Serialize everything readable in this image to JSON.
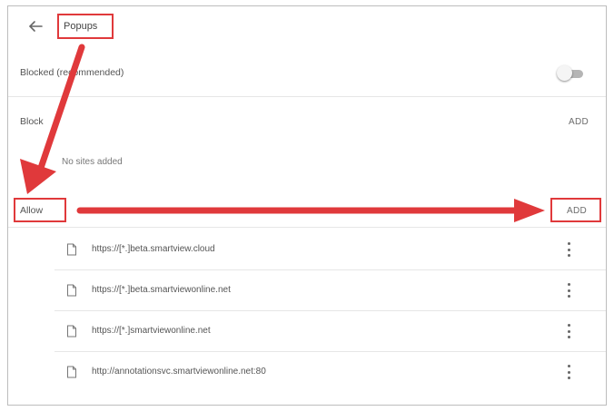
{
  "header": {
    "title": "Popups"
  },
  "blocked_setting": {
    "label": "Blocked (recommended)",
    "enabled": false
  },
  "block_section": {
    "label": "Block",
    "add_label": "ADD",
    "empty_text": "No sites added"
  },
  "allow_section": {
    "label": "Allow",
    "add_label": "ADD",
    "sites": [
      {
        "url": "https://[*.]beta.smartview.cloud"
      },
      {
        "url": "https://[*.]beta.smartviewonline.net"
      },
      {
        "url": "https://[*.]smartviewonline.net"
      },
      {
        "url": "http://annotationsvc.smartviewonline.net:80"
      }
    ]
  },
  "colors": {
    "annotation_red": "#e0393b",
    "text": "#555555",
    "divider": "#e6e6e6"
  },
  "icons": {
    "back": "back-arrow-icon",
    "site": "document-icon",
    "menu": "more-vert-icon"
  }
}
